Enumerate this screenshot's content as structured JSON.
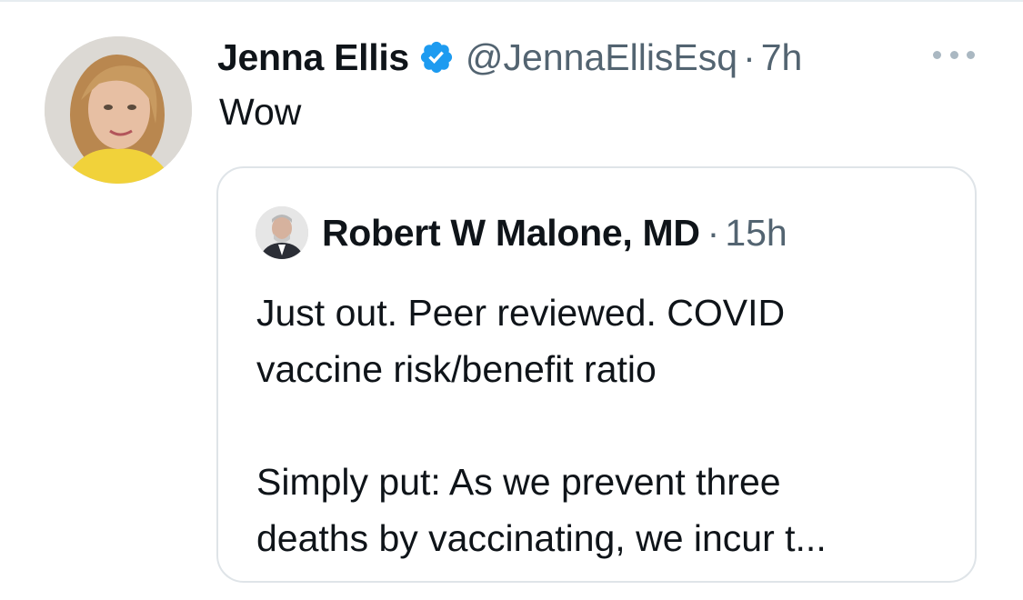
{
  "tweet": {
    "display_name": "Jenna Ellis",
    "handle": "@JennaEllisEsq",
    "separator": "·",
    "time": "7h",
    "text": "Wow",
    "verified_color": "#1d9bf0"
  },
  "quoted_tweet": {
    "display_name": "Robert W Malone, MD",
    "separator": "·",
    "time": "15h",
    "paragraph_1_line_1": "Just out.  Peer reviewed.  COVID",
    "paragraph_1_line_2": "vaccine risk/benefit ratio",
    "paragraph_2_line_1": "Simply put: As we prevent three",
    "paragraph_2_line_2": "deaths by vaccinating, we incur t..."
  },
  "icons": {
    "verified": "verified-badge-icon",
    "more": "more-options-icon"
  }
}
